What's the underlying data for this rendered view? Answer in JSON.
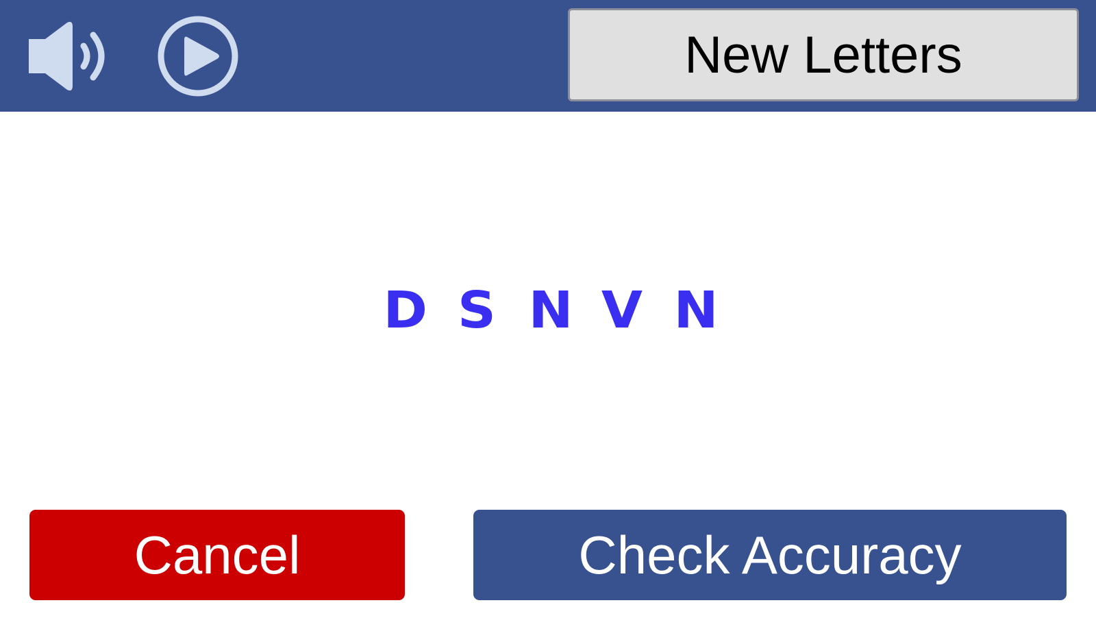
{
  "header": {
    "new_letters_label": "New Letters",
    "volume_icon": "speaker-volume-icon",
    "play_icon": "play-circle-icon"
  },
  "chart": {
    "letters": [
      "D",
      "S",
      "N",
      "V",
      "N"
    ]
  },
  "footer": {
    "cancel_label": "Cancel",
    "check_label": "Check Accuracy"
  },
  "colors": {
    "header_bg": "#38518f",
    "icon": "#cfdbee",
    "letters": "#3a2ff0",
    "cancel_bg": "#cc0000",
    "check_bg": "#38518f",
    "new_letters_bg": "#e0e0e0"
  }
}
